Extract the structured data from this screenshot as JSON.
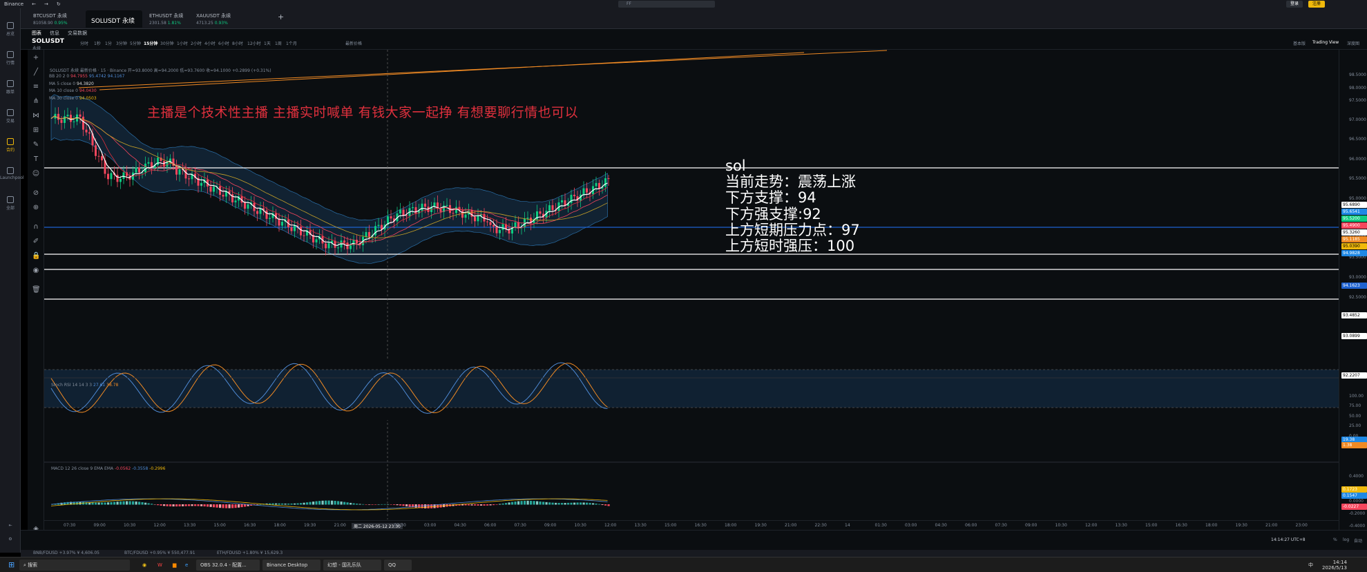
{
  "window": {
    "title": "Binance",
    "search_placeholder": "FF",
    "login": "登录",
    "register": "注册"
  },
  "nav": [
    "总览",
    "行情",
    "跟单",
    "交易",
    "合约",
    "Launchpool",
    "全部"
  ],
  "tabs": [
    {
      "symbol": "BTCUSDT 永续",
      "sub": "81058.90",
      "chg": "0.95%",
      "dir": "up"
    },
    {
      "symbol": "SOLUSDT 永续",
      "sub": "",
      "chg": "",
      "dir": "active"
    },
    {
      "symbol": "ETHUSDT 永续",
      "sub": "2301.58",
      "chg": "1.81%",
      "dir": "up"
    },
    {
      "symbol": "XAUUSDT 永续",
      "sub": "4713.25",
      "chg": "0.93%",
      "dir": "up"
    }
  ],
  "top_tabs": [
    "图表",
    "信息",
    "交易数据"
  ],
  "toolbar": {
    "symbol": "SOLUSDT",
    "symbol_sub": "永续",
    "intervals": [
      "分时",
      "1秒",
      "1分",
      "3分钟",
      "5分钟",
      "15分钟",
      "30分钟",
      "1小时",
      "2小时",
      "4小时",
      "6小时",
      "8小时",
      "12小时",
      "1天",
      "1周",
      "1个月"
    ],
    "active_interval": "15分钟",
    "price_type": "最新价格",
    "right": [
      "基本版",
      "Trading View",
      "深度图"
    ]
  },
  "chart_head": "SOLUSDT 永续 最新价格 · 15 · Binance  开=93.8000 高=94.2000 低=93.7600 收=94.1000 +0.2899 (+0.31%)",
  "overlays": [
    {
      "label": "BB 20 2 0",
      "vals": [
        "94.7955",
        "95.4742",
        "94.1167"
      ]
    },
    {
      "label": "MA 5 close 0",
      "vals": [
        "94.3820"
      ]
    },
    {
      "label": "MA 10 close 0",
      "vals": [
        "94.0430"
      ]
    },
    {
      "label": "MA 30 close 0",
      "vals": [
        "94.0503"
      ]
    }
  ],
  "banner": "主播是个技术性主播 主播实时喊单 有钱大家一起挣 有想要聊行情也可以",
  "notes": [
    "sol",
    "当前走势：震荡上涨",
    "下方支撑：94",
    "下方强支撑:92",
    "上方短期压力点：97",
    "上方短时强压：100"
  ],
  "price_ticks": [
    "98.5000",
    "98.0000",
    "97.5000",
    "97.0000",
    "96.5000",
    "96.0000",
    "95.5000",
    "95.0000",
    "94.5000",
    "94.0000",
    "93.5000",
    "93.0000",
    "92.5000"
  ],
  "price_labels": [
    {
      "v": "95.6890",
      "bg": "#ffffff",
      "fg": "#000"
    },
    {
      "v": "95.6541",
      "bg": "#1e88e5",
      "fg": "#fff"
    },
    {
      "v": "95.5200",
      "bg": "#0ecb81",
      "fg": "#fff"
    },
    {
      "v": "95.4900",
      "bg": "#f6465d",
      "fg": "#fff"
    },
    {
      "v": "95.3260",
      "bg": "#ffffff",
      "fg": "#000"
    },
    {
      "v": "95.1185",
      "bg": "#f08a24",
      "fg": "#fff"
    },
    {
      "v": "95.0390",
      "bg": "#f0b90b",
      "fg": "#000"
    },
    {
      "v": "94.9828",
      "bg": "#1e88e5",
      "fg": "#fff"
    },
    {
      "v": "94.1623",
      "bg": "#1e62d0",
      "fg": "#fff"
    },
    {
      "v": "93.4852",
      "bg": "#ffffff",
      "fg": "#000"
    },
    {
      "v": "93.0899",
      "bg": "#ffffff",
      "fg": "#000"
    },
    {
      "v": "92.2207",
      "bg": "#ffffff",
      "fg": "#000"
    }
  ],
  "srsi": {
    "label": "Stoch RSI 14 14 3 3",
    "k": "27.61",
    "d": "38.78",
    "ticks": [
      "100.00",
      "75.00",
      "50.00",
      "25.00",
      "0.00"
    ],
    "k_badge": "19.38",
    "d_badge": "1.38"
  },
  "macd": {
    "label": "MACD 12 26 close 9 EMA EMA",
    "vals": [
      "-0.0562",
      "-0.3558",
      "-0.2996"
    ],
    "ticks": [
      "0.4000",
      "0.2000",
      "0.0000",
      "-0.2000",
      "-0.4000"
    ],
    "badges": [
      "0.1723",
      "0.1547",
      "-0.0227"
    ]
  },
  "time_ticks": [
    "07:30",
    "09:00",
    "10:30",
    "12:00",
    "13:30",
    "15:00",
    "16:30",
    "18:00",
    "19:30",
    "21:00",
    "周二 2026-05-12 23:30",
    "01:30",
    "03:00",
    "04:30",
    "06:00",
    "07:30",
    "09:00",
    "10:30",
    "12:00",
    "13:30",
    "15:00",
    "16:30",
    "18:00",
    "19:30",
    "21:00",
    "22:30",
    "14",
    "01:30",
    "03:00",
    "04:30",
    "06:00",
    "07:30",
    "09:00",
    "10:30",
    "12:00",
    "13:30",
    "15:00",
    "16:30",
    "18:00",
    "19:30",
    "21:00",
    "23:00"
  ],
  "bottom": {
    "clock": "14:14:27 UTC+8",
    "pct": "%",
    "log": "log",
    "auto": "自动"
  },
  "tickers": [
    "BNB/FDUSD +3.97% ¥ 4,606.05",
    "BTC/FDUSD +0.95% ¥ 550,477.91",
    "ETH/FDUSD +1.80% ¥ 15,629.3"
  ],
  "taskbar": {
    "search": "搜索",
    "apps": [
      "OBS 32.0.4 - 配置...",
      "Binance Desktop",
      "幻想 - 国孔乐队",
      "QQ"
    ],
    "time": "14:14",
    "date": "2026/5/13",
    "ime": "中"
  },
  "colors": {
    "up": "#0ecb81",
    "down": "#f6465d",
    "brand": "#f0b90b"
  }
}
